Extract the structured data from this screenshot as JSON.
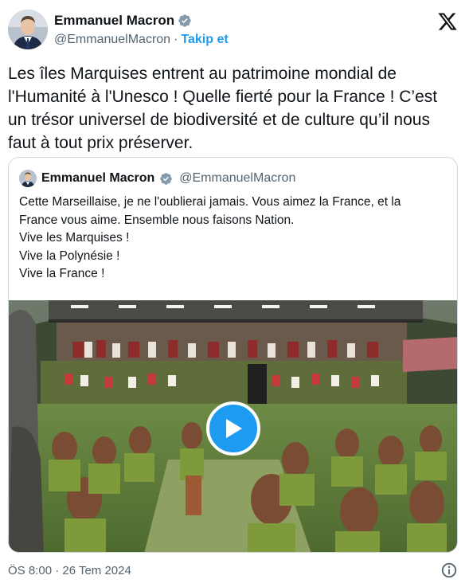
{
  "author": {
    "name": "Emmanuel Macron",
    "handle": "@EmmanuelMacron",
    "separator": "·",
    "follow_label": "Takip et"
  },
  "tweet": {
    "text": "Les îles Marquises entrent au patrimoine mondial de l'Humanité à l'Unesco ! Quelle fierté pour la France ! C’est un trésor universel de biodiversité et de culture qu’il nous faut à tout prix préserver."
  },
  "quoted": {
    "name": "Emmanuel Macron",
    "handle": "@EmmanuelMacron",
    "lines": [
      "Cette Marseillaise, je ne l'oublierai jamais. Vous aimez la France, et la",
      "France vous aime. Ensemble nous faisons Nation.",
      "Vive les Marquises !",
      "Vive la Polynésie !",
      "Vive la France !"
    ]
  },
  "footer": {
    "timestamp": "ÖS 8:00 · 26 Tem 2024"
  },
  "icons": {
    "verified": "verified-badge-icon",
    "x_logo": "x-logo-icon",
    "play": "play-icon",
    "info": "info-icon"
  },
  "colors": {
    "accent": "#1d9bf0",
    "text": "#0f1419",
    "secondary": "#536471",
    "border": "#cfd9de"
  }
}
